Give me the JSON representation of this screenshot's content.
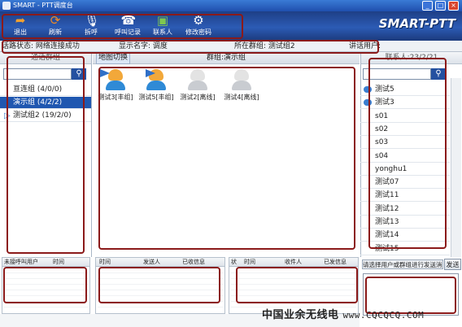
{
  "window": {
    "title": "SMART - PTT调度台",
    "controls": [
      "_",
      "□",
      "×"
    ]
  },
  "toolbar": {
    "buttons": [
      {
        "label": "退出",
        "icon": "exit-icon",
        "glyph": "➦",
        "color": "#f0a030"
      },
      {
        "label": "刷新",
        "icon": "refresh-icon",
        "glyph": "⟳",
        "color": "#f08a24"
      },
      {
        "label": "拆呼",
        "icon": "microphone-icon",
        "glyph": "🎙",
        "color": "#ffffff"
      },
      {
        "label": "呼叫记录",
        "icon": "call-log-icon",
        "glyph": "☎",
        "color": "#ffffff"
      },
      {
        "label": "联系人",
        "icon": "contacts-icon",
        "glyph": "▣",
        "color": "#7ec850"
      },
      {
        "label": "修改密码",
        "icon": "gear-icon",
        "glyph": "⚙",
        "color": "#ffffff"
      }
    ],
    "logo": "SMART-PTT"
  },
  "status": {
    "conn": "话路状态: 网络连接成功",
    "name": "显示名字: 调度",
    "group": "所在群组: 测试组2",
    "speaker": "讲话用户:"
  },
  "left": {
    "header": "通话群组",
    "groups": [
      {
        "label": "亘连组 (4/0/0)",
        "selected": false
      },
      {
        "label": "演示组 (4/2/2)",
        "selected": true
      },
      {
        "label": "测试组2 (19/2/0)",
        "selected": false
      }
    ]
  },
  "middle": {
    "tab_map": "地图切换",
    "group_label": "群组:演示组",
    "users": [
      {
        "name": "测试3[丰组]",
        "online": true
      },
      {
        "name": "测试5[丰组]",
        "online": true
      },
      {
        "name": "测试2[离线]",
        "online": false
      },
      {
        "name": "测试4[离线]",
        "online": false
      }
    ]
  },
  "right": {
    "header": "联系人:23/2/21",
    "contacts": [
      "测试5",
      "测试3",
      "s01",
      "s02",
      "s03",
      "s04",
      "yonghu1",
      "测试07",
      "测试11",
      "测试12",
      "测试13",
      "测试14",
      "测试15"
    ]
  },
  "bottom": {
    "missed": {
      "headers": [
        "未接呼叫用户",
        "时间"
      ]
    },
    "received": {
      "headers": [
        "时间",
        "发送人",
        "已收信息"
      ]
    },
    "sent": {
      "headers": [
        "状",
        "时间",
        "收件人",
        "已发信息"
      ]
    },
    "send_hint": "请选择用户或群组进行发送消息",
    "send_button": "发送"
  },
  "watermark": {
    "cn": "中国业余无线电",
    "url": "www.CQCQCQ.COM"
  },
  "colors": {
    "accent": "#1f57b0",
    "annotation": "#8b1a1a",
    "online": "#3a7ed0",
    "offline": "#b9bec6"
  }
}
